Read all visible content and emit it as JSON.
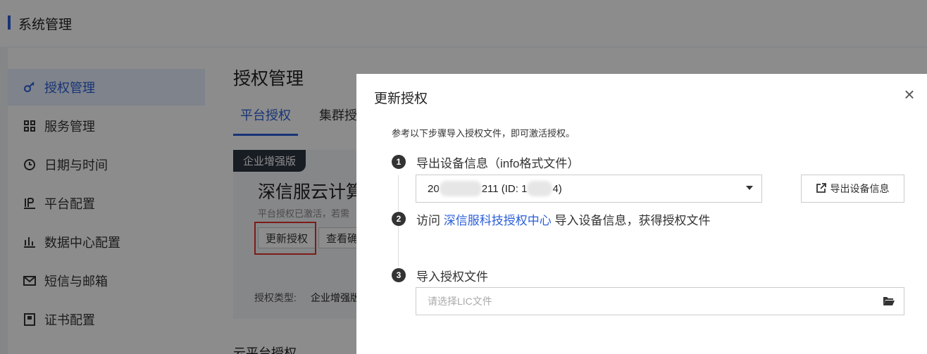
{
  "header": {
    "title": "系统管理"
  },
  "sidebar": {
    "items": [
      {
        "label": "授权管理",
        "icon": "key-icon"
      },
      {
        "label": "服务管理",
        "icon": "grid-icon"
      },
      {
        "label": "日期与时间",
        "icon": "clock-icon"
      },
      {
        "label": "平台配置",
        "icon": "ip-icon"
      },
      {
        "label": "数据中心配置",
        "icon": "bar-chart-icon"
      },
      {
        "label": "短信与邮箱",
        "icon": "mail-icon"
      },
      {
        "label": "证书配置",
        "icon": "certificate-icon"
      }
    ]
  },
  "main": {
    "title": "授权管理",
    "tabs": [
      "平台授权",
      "集群授权"
    ],
    "card": {
      "badge": "企业增强版",
      "product": "深信服云计算",
      "note": "平台授权已激活，若需",
      "update_button": "更新授权",
      "view_button": "查看确认",
      "type_label": "授权类型:",
      "type_value": "企业增强版"
    },
    "section_title": "云平台授权"
  },
  "dialog": {
    "title": "更新授权",
    "intro": "参考以下步骤导入授权文件，即可激活授权。",
    "step1": {
      "num": "1",
      "label": "导出设备信息（info格式文件）"
    },
    "device_select": {
      "prefix": "20",
      "middle": "211  (ID:  1",
      "suffix": "4)"
    },
    "export_button": "导出设备信息",
    "step2": {
      "num": "2",
      "prefix": "访问 ",
      "link": "深信服科技授权中心",
      "suffix": " 导入设备信息，获得授权文件"
    },
    "step3": {
      "num": "3",
      "label": "导入授权文件"
    },
    "file_placeholder": "请选择LIC文件"
  },
  "colors": {
    "accent": "#2b5fd9",
    "highlight": "#e3342f"
  }
}
